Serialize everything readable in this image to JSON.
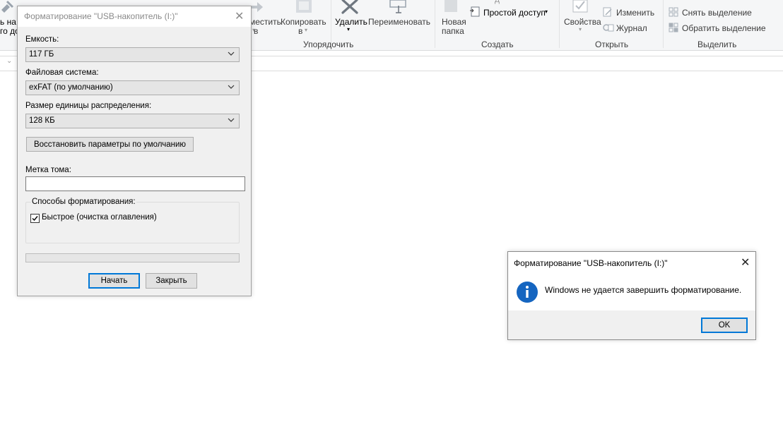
{
  "ribbon": {
    "partial_left_line1": "ь на",
    "partial_left_line2": "го до",
    "move_to": {
      "line1": "местить",
      "line2": "в"
    },
    "copy_to": {
      "line1": "Копировать",
      "line2": "в"
    },
    "delete_label": "Удалить",
    "rename_label": "Переименовать",
    "new_folder": {
      "line1": "Новая",
      "line2": "папка"
    },
    "easy_access_label": "Простой доступ",
    "properties_label": "Свойства",
    "edit_label": "Изменить",
    "history_label": "Журнал",
    "select_none_label": "Снять выделение",
    "invert_selection_label": "Обратить выделение",
    "groups": {
      "organize": "Упорядочить",
      "new": "Создать",
      "open": "Открыть",
      "select": "Выделить"
    }
  },
  "format_dialog": {
    "title": "Форматирование \"USB-накопитель (I:)\"",
    "capacity_label": "Емкость:",
    "capacity_value": "117 ГБ",
    "filesystem_label": "Файловая система:",
    "filesystem_value": "exFAT (по умолчанию)",
    "allocation_label": "Размер единицы распределения:",
    "allocation_value": "128 КБ",
    "restore_defaults_label": "Восстановить параметры по умолчанию",
    "volume_label_label": "Метка тома:",
    "volume_label_value": "",
    "format_options_label": "Способы форматирования:",
    "quick_format_label": "Быстрое (очистка оглавления)",
    "quick_format_checked": true,
    "progress": 0,
    "start_label": "Начать",
    "close_label": "Закрыть"
  },
  "error_dialog": {
    "title": "Форматирование \"USB-накопитель (I:)\"",
    "message": "Windows не удается завершить форматирование.",
    "ok_label": "OK",
    "icon": "info-icon"
  },
  "colors": {
    "accent": "#0078d7",
    "info_icon": "#1565c0",
    "ribbon_bg": "#f5f6f7",
    "dialog_bg": "#f0f0f0"
  }
}
